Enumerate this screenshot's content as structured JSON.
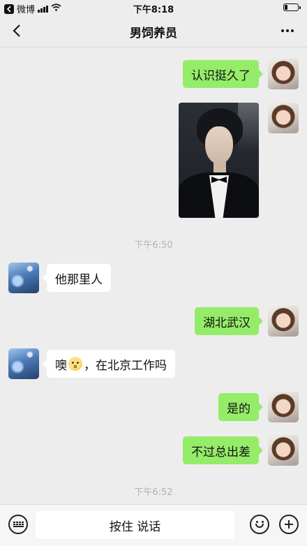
{
  "status_bar": {
    "back_app": "微博",
    "time": "下午8:18",
    "battery_level": 0.2,
    "icons": [
      "chevron-left-icon",
      "signal-icon",
      "wifi-icon",
      "battery-icon"
    ]
  },
  "nav": {
    "title": "男饲养员",
    "icons": [
      "back-arrow-icon",
      "more-dots-icon"
    ]
  },
  "messages": [
    {
      "from": "me",
      "type": "text",
      "text": "认识挺久了"
    },
    {
      "from": "me",
      "type": "image",
      "icon": "photo-man-in-tuxedo"
    },
    {
      "type": "time",
      "text": "下午6:50"
    },
    {
      "from": "other",
      "type": "text",
      "text": "他那里人"
    },
    {
      "from": "me",
      "type": "text",
      "text": "湖北武汉"
    },
    {
      "from": "other",
      "type": "text",
      "text_before": "噢",
      "emoji": "hushed-face-emoji",
      "text_after": "，在北京工作吗"
    },
    {
      "from": "me",
      "type": "text",
      "text": "是的"
    },
    {
      "from": "me",
      "type": "text",
      "text": "不过总出差"
    },
    {
      "type": "time",
      "text": "下午6:52"
    }
  ],
  "input_bar": {
    "voice_label": "按住 说话",
    "icons": [
      "keyboard-icon",
      "emoji-icon",
      "plus-icon"
    ]
  },
  "colors": {
    "background": "#ededed",
    "my_bubble": "#95ec69",
    "other_bubble": "#ffffff",
    "timestamp": "#b2b2b2"
  }
}
